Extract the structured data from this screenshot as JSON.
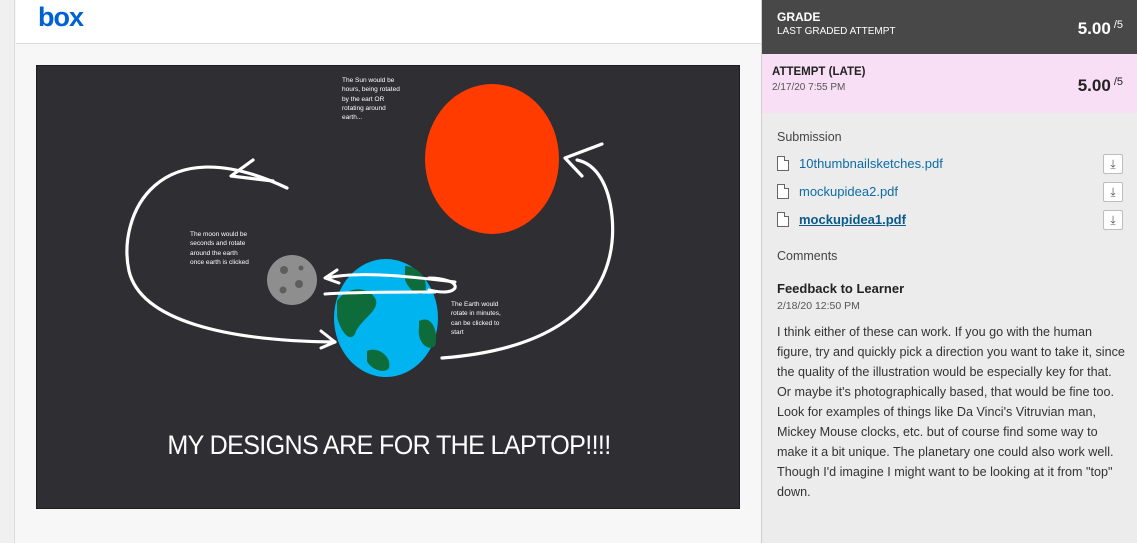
{
  "viewer": {
    "logo": "box",
    "slide": {
      "sun_note": "The Sun would be hours, being rotated by the eart OR rotating around earth...",
      "moon_note": "The moon would be seconds and rotate around the earth once earth is clicked",
      "earth_note": "The Earth would rotate in minutes, can be clicked to start",
      "caption": "MY DESIGNS ARE FOR THE LAPTOP!!!!",
      "colors": {
        "background": "#2e2e33",
        "sun": "#ff3b00",
        "earth_water": "#00b4ef",
        "earth_land": "#0e6b3a",
        "moon": "#8e8e8e"
      }
    }
  },
  "grade": {
    "title": "GRADE",
    "subtitle": "LAST GRADED ATTEMPT",
    "score": "5.00",
    "denominator": "/5"
  },
  "attempt": {
    "title": "ATTEMPT (LATE)",
    "date": "2/17/20 7:55 PM",
    "score": "5.00",
    "denominator": "/5"
  },
  "submission": {
    "label": "Submission",
    "files": [
      {
        "name": "10thumbnailsketches.pdf",
        "icon": "file-icon",
        "action_icon": "download-icon"
      },
      {
        "name": "mockupidea2.pdf",
        "icon": "file-icon",
        "action_icon": "download-icon"
      },
      {
        "name": "mockupidea1.pdf",
        "icon": "file-icon",
        "action_icon": "download-icon"
      }
    ]
  },
  "comments": {
    "label": "Comments",
    "feedback_title": "Feedback to Learner",
    "feedback_date": "2/18/20 12:50 PM",
    "feedback_text": "I think either of these can work. If you go with the human figure, try and quickly pick a direction you want to take it, since the quality of the illustration would be especially key for that. Or maybe it's photographically based, that would be fine too. Look for examples of things like Da Vinci's Vitruvian man, Mickey Mouse clocks, etc. but of course find some way to make it a bit unique. The planetary one could also work well. Though I'd imagine I might want to be looking at it from \"top\" down."
  },
  "accent_colors": {
    "link": "#0d6ca6",
    "grade_bar": "#484848",
    "late_bar": "#f8dff5",
    "box_blue": "#0061d5"
  }
}
